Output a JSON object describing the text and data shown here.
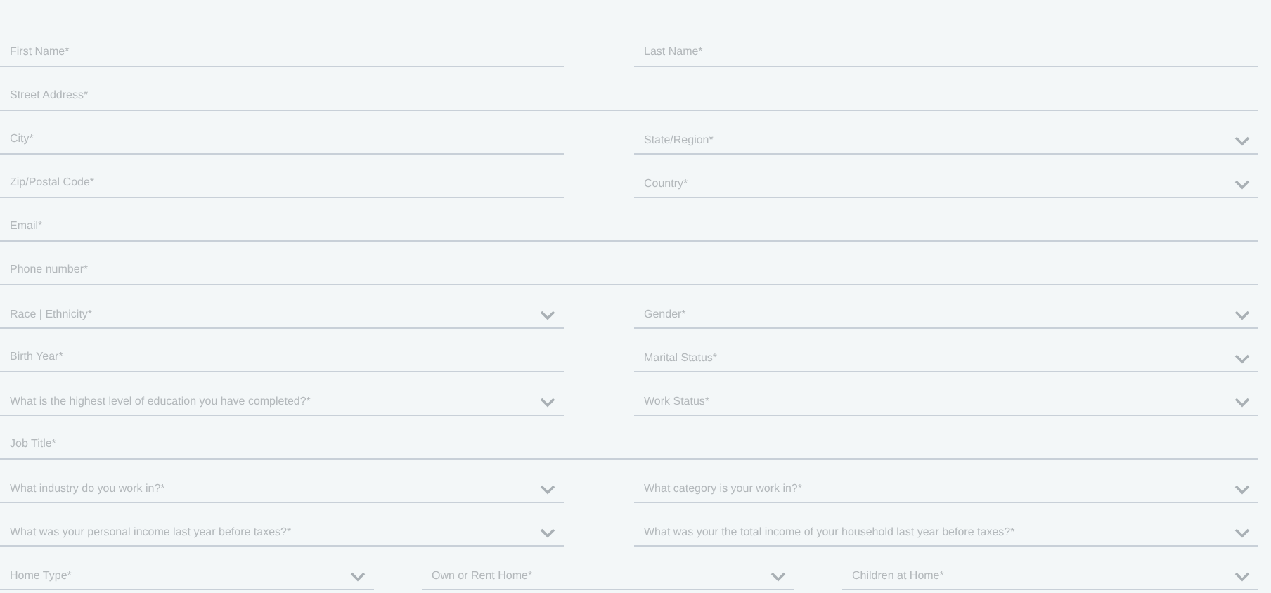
{
  "rows": [
    {
      "fields": [
        {
          "kind": "text",
          "placeholder": "First Name*"
        },
        {
          "kind": "text",
          "placeholder": "Last Name*"
        }
      ]
    },
    {
      "fields": [
        {
          "kind": "text",
          "placeholder": "Street Address*"
        }
      ]
    },
    {
      "fields": [
        {
          "kind": "text",
          "placeholder": "City*"
        },
        {
          "kind": "select",
          "placeholder": "State/Region*"
        }
      ]
    },
    {
      "fields": [
        {
          "kind": "text",
          "placeholder": "Zip/Postal Code*"
        },
        {
          "kind": "select",
          "placeholder": "Country*"
        }
      ]
    },
    {
      "fields": [
        {
          "kind": "text",
          "placeholder": "Email*"
        }
      ]
    },
    {
      "fields": [
        {
          "kind": "text",
          "placeholder": "Phone number*"
        }
      ]
    },
    {
      "fields": [
        {
          "kind": "select",
          "placeholder": "Race | Ethnicity*"
        },
        {
          "kind": "select",
          "placeholder": "Gender*"
        }
      ]
    },
    {
      "fields": [
        {
          "kind": "text",
          "placeholder": "Birth Year*"
        },
        {
          "kind": "select",
          "placeholder": "Marital Status*"
        }
      ]
    },
    {
      "fields": [
        {
          "kind": "select",
          "placeholder": "What is the highest level of education you have completed?*"
        },
        {
          "kind": "select",
          "placeholder": "Work Status*"
        }
      ]
    },
    {
      "fields": [
        {
          "kind": "text",
          "placeholder": "Job Title*"
        }
      ]
    },
    {
      "fields": [
        {
          "kind": "select",
          "placeholder": "What industry do you work in?*"
        },
        {
          "kind": "select",
          "placeholder": "What category is your work in?*"
        }
      ]
    },
    {
      "fields": [
        {
          "kind": "select",
          "placeholder": "What was your personal income last year before taxes?*"
        },
        {
          "kind": "select",
          "placeholder": "What was your the total income of your household last year before taxes?*"
        }
      ]
    },
    {
      "fields": [
        {
          "kind": "select",
          "placeholder": "Home Type*"
        },
        {
          "kind": "select",
          "placeholder": "Own or Rent Home*"
        },
        {
          "kind": "select",
          "placeholder": "Children at Home*"
        }
      ]
    }
  ]
}
